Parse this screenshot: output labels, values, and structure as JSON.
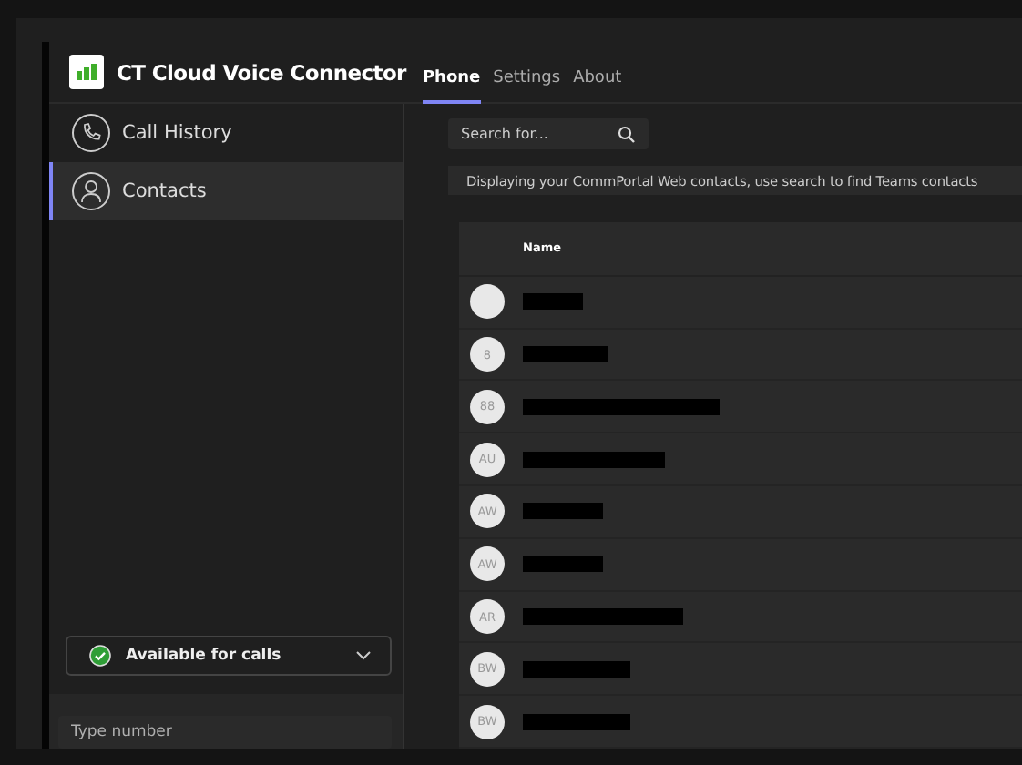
{
  "app": {
    "title": "CT Cloud Voice Connector"
  },
  "tabs": [
    {
      "label": "Phone",
      "selected": true
    },
    {
      "label": "Settings",
      "selected": false
    },
    {
      "label": "About",
      "selected": false
    }
  ],
  "sidebar": {
    "items": [
      {
        "label": "Call History",
        "kind": "phone",
        "selected": false
      },
      {
        "label": "Contacts",
        "kind": "person",
        "selected": true
      }
    ],
    "status": {
      "label": "Available for calls",
      "available": true
    },
    "dial": {
      "placeholder": "Type number"
    }
  },
  "search": {
    "placeholder": "Search for..."
  },
  "notice": "Displaying your CommPortal Web contacts, use search to find Teams contacts",
  "table": {
    "columns": [
      "Name"
    ],
    "rows": [
      {
        "redacted": true
      },
      {
        "initials": "8",
        "redacted": true
      },
      {
        "initials": "88",
        "redacted": true
      },
      {
        "initials": "AU",
        "redacted": true
      },
      {
        "initials": "AW",
        "redacted": true
      },
      {
        "initials": "AW",
        "redacted": true
      },
      {
        "initials": "AR",
        "redacted": true
      },
      {
        "initials": "BW",
        "redacted": true
      },
      {
        "initials": "BW",
        "redacted": true
      }
    ]
  }
}
